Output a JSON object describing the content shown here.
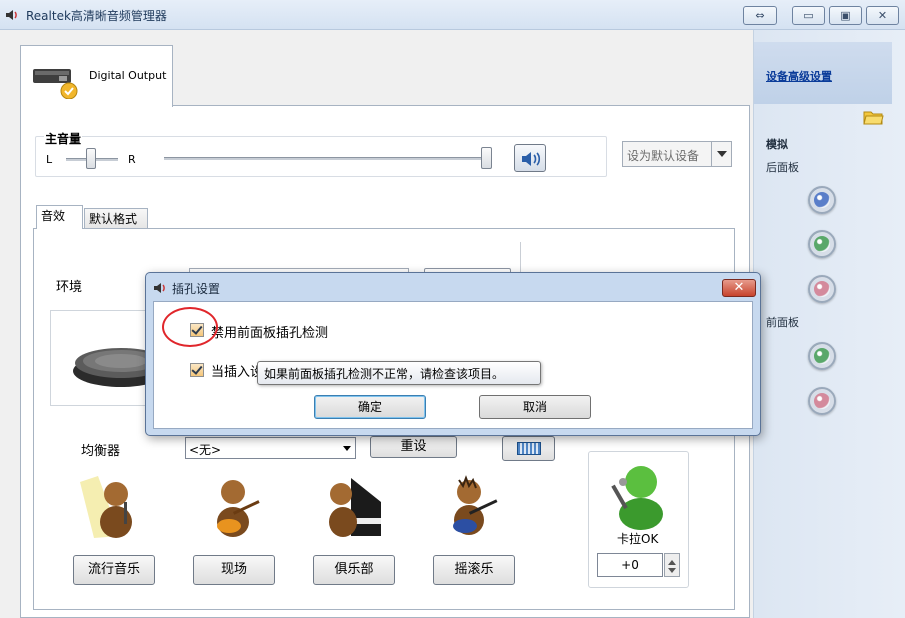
{
  "window": {
    "title": "Realtek高清晰音频管理器",
    "restore_glyph": "⇔",
    "min_glyph": "▭",
    "max_glyph": "▣",
    "close_glyph": "✕"
  },
  "side": {
    "advanced_link": "设备高级设置",
    "analog_label": "模拟",
    "back_panel_label": "后面板",
    "front_panel_label": "前面板",
    "jack_colors": [
      "#5a7ec9",
      "#5aa86a",
      "#d48a9c",
      "#5aa86a",
      "#d48a9c"
    ]
  },
  "device_tab": {
    "label": "Digital Output"
  },
  "master_volume": {
    "title": "主音量",
    "left": "L",
    "right": "R",
    "default_device": "设为默认设备"
  },
  "tabs": {
    "effects": "音效",
    "default_format": "默认格式"
  },
  "environment": {
    "label": "环境"
  },
  "equalizer": {
    "label": "均衡器",
    "selected": "<无>",
    "reset": "重设",
    "presets": [
      "流行音乐",
      "现场",
      "俱乐部",
      "摇滚乐"
    ]
  },
  "karaoke": {
    "label": "卡拉OK",
    "value": "+0"
  },
  "dialog": {
    "title": "插孔设置",
    "close": "✕",
    "option1": "禁用前面板插孔检测",
    "option2_prefix": "当插入设",
    "tooltip": "如果前面板插孔检测不正常，请检查该项目。",
    "ok": "确定",
    "cancel": "取消"
  }
}
